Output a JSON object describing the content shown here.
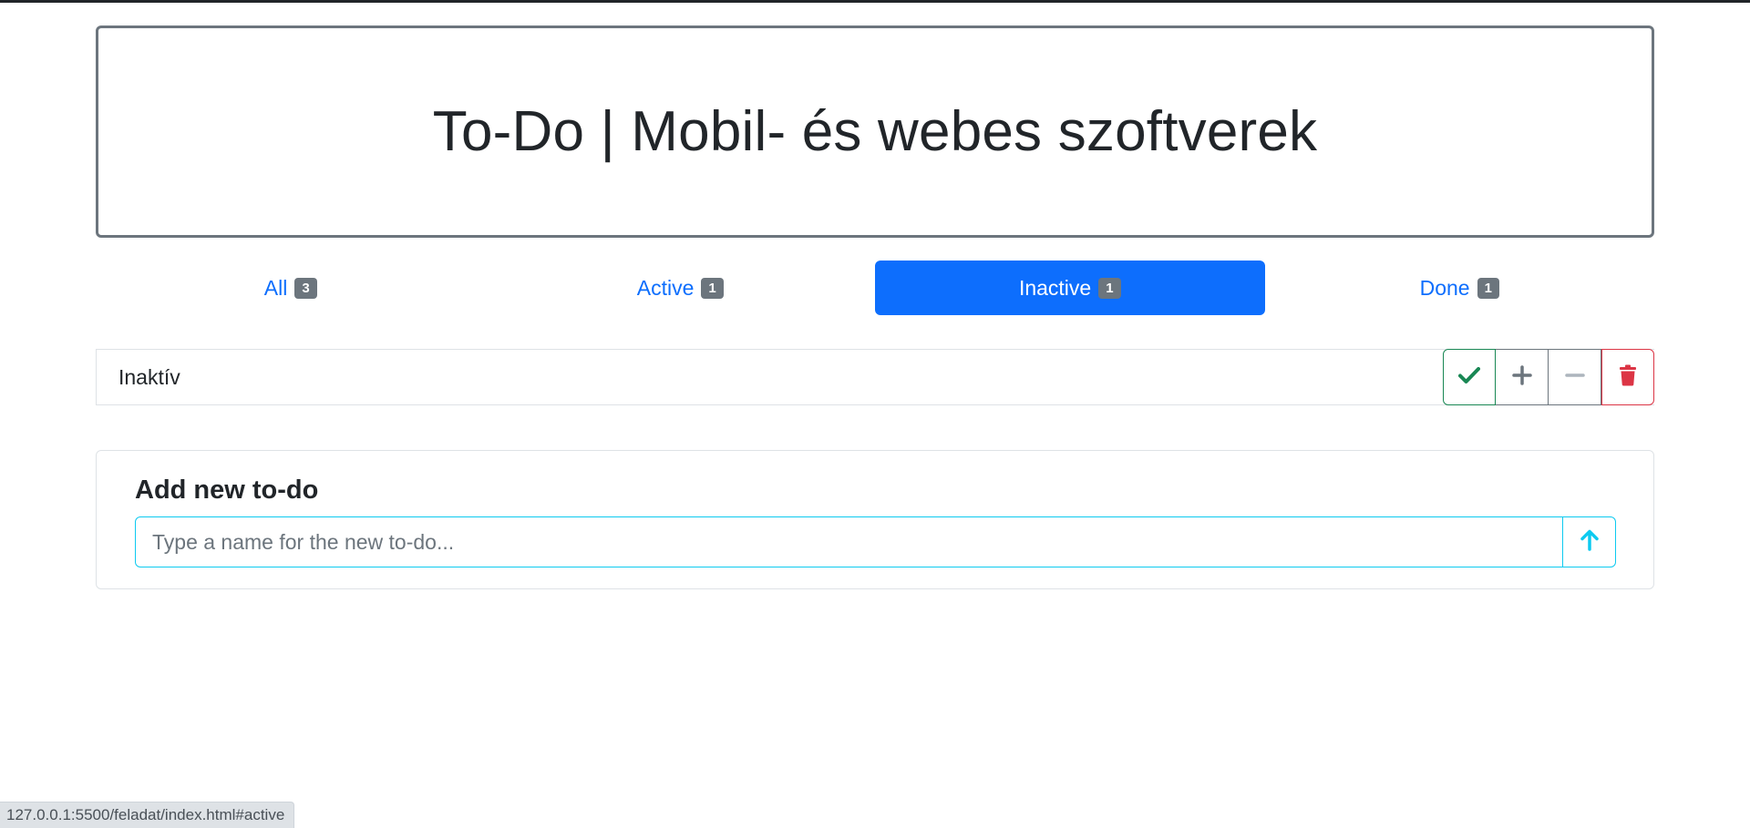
{
  "header": {
    "title": "To-Do | Mobil- és webes szoftverek"
  },
  "tabs": [
    {
      "label": "All",
      "count": "3",
      "active": false
    },
    {
      "label": "Active",
      "count": "1",
      "active": false
    },
    {
      "label": "Inactive",
      "count": "1",
      "active": true
    },
    {
      "label": "Done",
      "count": "1",
      "active": false
    }
  ],
  "todo": {
    "name": "Inaktív",
    "actions": {
      "done_icon": "check-icon",
      "plus_icon": "plus-icon",
      "minus_icon": "minus-icon",
      "delete_icon": "trash-icon"
    }
  },
  "add_form": {
    "heading": "Add new to-do",
    "placeholder": "Type a name for the new to-do...",
    "value": "",
    "submit_icon": "arrow-up-icon"
  },
  "statusbar": {
    "url": "127.0.0.1:5500/feladat/index.html#active"
  },
  "colors": {
    "primary": "#0d6efd",
    "success": "#198754",
    "secondary": "#6c757d",
    "danger": "#dc3545",
    "info": "#0dcaf0"
  }
}
